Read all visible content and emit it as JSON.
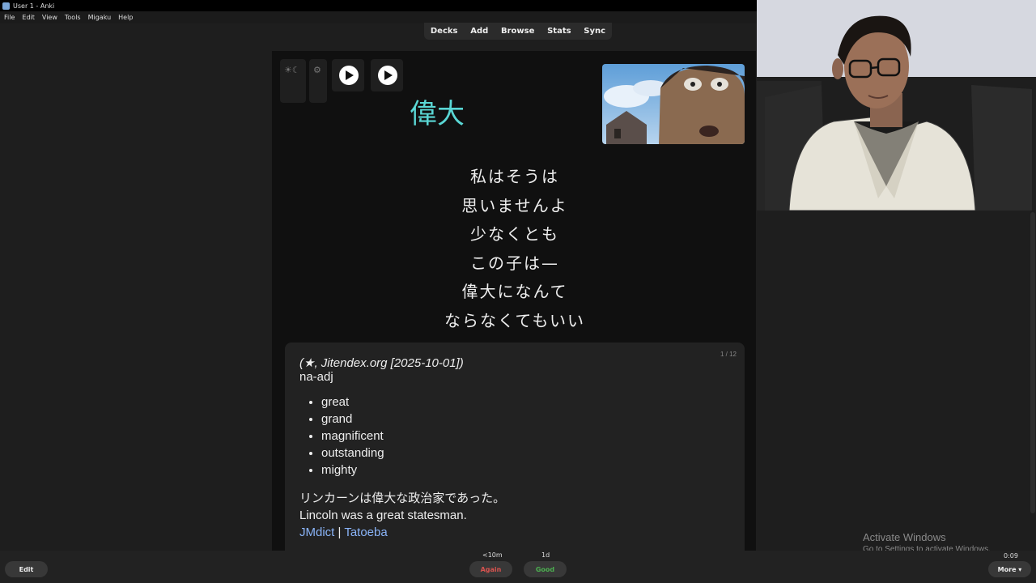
{
  "window": {
    "title": "User 1 - Anki"
  },
  "menu": [
    "File",
    "Edit",
    "View",
    "Tools",
    "Migaku",
    "Help"
  ],
  "toolbar": [
    "Decks",
    "Add",
    "Browse",
    "Stats",
    "Sync"
  ],
  "card": {
    "word": "偉大",
    "sentence_lines": [
      "私はそうは",
      "思いませんよ",
      "少なくとも",
      "この子は—",
      "偉大になんて",
      "ならなくてもいい"
    ],
    "definition": {
      "counter": "1 / 12",
      "source": "(★, Jitendex.org [2025-10-01])",
      "pos": "na-adj",
      "glosses": [
        "great",
        "grand",
        "magnificent",
        "outstanding",
        "mighty"
      ],
      "example_jp": "リンカーンは偉大な政治家であった。",
      "example_en": "Lincoln was a great statesman.",
      "link1": "JMdict",
      "separator": "|",
      "link2": "Tatoeba"
    }
  },
  "bottom": {
    "edit": "Edit",
    "again_label": "Again",
    "again_time": "<10m",
    "good_label": "Good",
    "good_time": "1d",
    "timer": "0:09",
    "more": "More ▾"
  },
  "watermark": {
    "line1": "Activate Windows",
    "line2": "Go to Settings to activate Windows."
  },
  "colors": {
    "word": "#5ad7d5",
    "again": "#d9534f",
    "good": "#4caf50",
    "link": "#8ab4f8"
  }
}
